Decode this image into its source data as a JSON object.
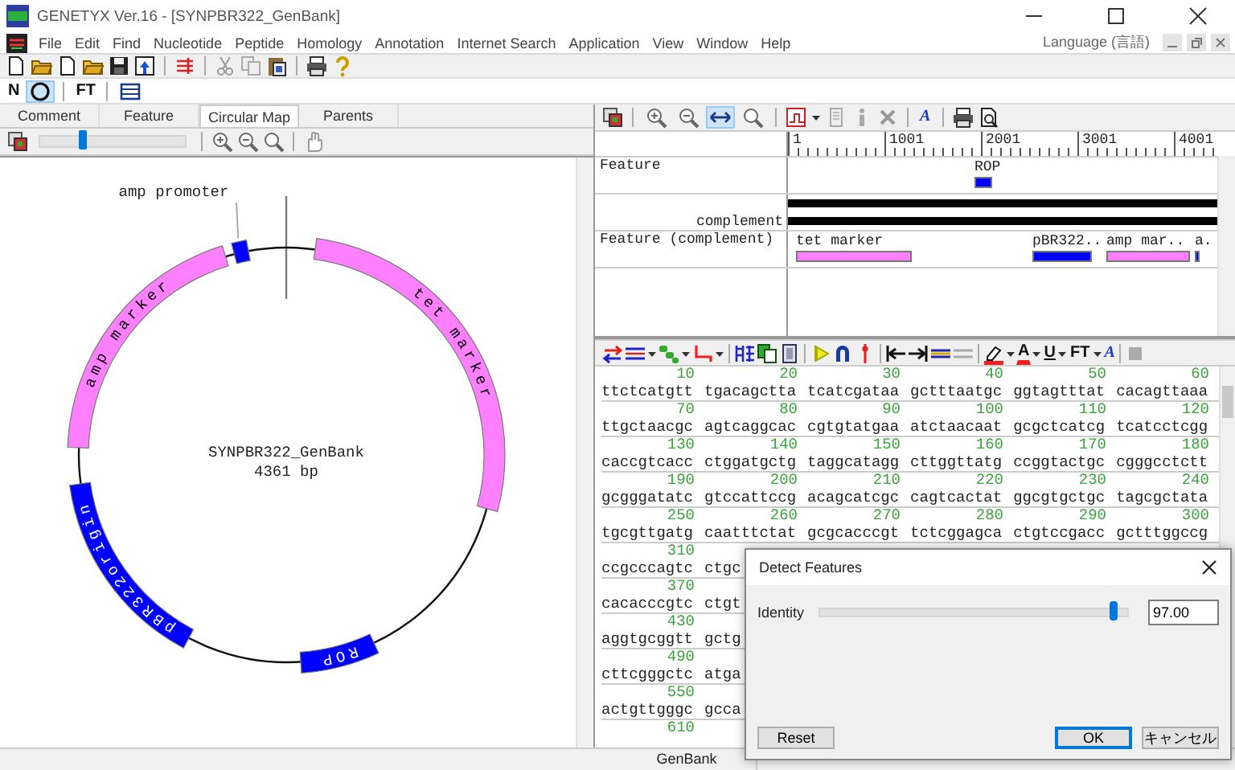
{
  "window": {
    "title": "GENETYX Ver.16 - [SYNPBR322_GenBank]"
  },
  "menu": [
    "File",
    "Edit",
    "Find",
    "Nucleotide",
    "Peptide",
    "Homology",
    "Annotation",
    "Internet Search",
    "Application",
    "View",
    "Window",
    "Help"
  ],
  "language": "Language (言語)",
  "main_toolbar": [
    [
      {
        "kind": "page"
      },
      {
        "kind": "folder"
      },
      {
        "kind": "page"
      },
      {
        "kind": "folder"
      },
      {
        "kind": "floppy"
      },
      {
        "kind": "floppy-blue"
      }
    ],
    [
      {
        "kind": "lines-red"
      }
    ],
    [
      {
        "kind": "scissors"
      },
      {
        "kind": "copy"
      },
      {
        "kind": "paste"
      }
    ],
    [
      {
        "kind": "printer"
      },
      {
        "kind": "help"
      }
    ]
  ],
  "view_toolbar": [
    [
      {
        "kind": "text",
        "label": "N",
        "selected": false
      },
      {
        "kind": "circle",
        "selected": true
      }
    ],
    [
      {
        "kind": "text",
        "label": "FT",
        "selected": false
      }
    ],
    [
      {
        "kind": "layout",
        "selected": false
      }
    ]
  ],
  "tabs": [
    {
      "label": "Comment",
      "selected": false
    },
    {
      "label": "Feature",
      "selected": false
    },
    {
      "label": "Circular Map",
      "selected": true
    },
    {
      "label": "Parents",
      "selected": false
    }
  ],
  "map_toolbar": {
    "leading": [
      [
        {
          "kind": "image"
        }
      ]
    ],
    "zoom_slider": {
      "level": 0.3
    },
    "tools": [
      [
        {
          "kind": "zoom-in"
        },
        {
          "kind": "zoom-out"
        },
        {
          "kind": "zoom"
        }
      ],
      [
        {
          "kind": "hand"
        }
      ]
    ]
  },
  "circular_map": {
    "name": "SYNPBR322_GenBank",
    "length": "4361 bp",
    "features": [
      {
        "label": "amp promoter",
        "color": "#0000ff",
        "kind": "callout"
      },
      {
        "label": "amp marker",
        "color": "#ff80ff",
        "kind": "band"
      },
      {
        "label": "tet marker",
        "color": "#ff80ff",
        "kind": "band"
      },
      {
        "label": "pBR322origin",
        "color": "#0000ff",
        "kind": "band"
      },
      {
        "label": "ROP",
        "color": "#0000ff",
        "kind": "band"
      }
    ]
  },
  "feature_toolbar": [
    [
      {
        "kind": "image"
      }
    ],
    [
      {
        "kind": "zoom-in",
        "selected": false
      },
      {
        "kind": "zoom-out",
        "selected": false
      },
      {
        "kind": "fit",
        "selected": true
      },
      {
        "kind": "zoom",
        "selected": false
      }
    ],
    [
      {
        "kind": "graph"
      },
      {
        "kind": "caret"
      },
      {
        "kind": "page-grey"
      },
      {
        "kind": "info"
      },
      {
        "kind": "cross"
      }
    ],
    [
      {
        "kind": "italic",
        "label": "A"
      }
    ],
    [
      {
        "kind": "printer"
      },
      {
        "kind": "preview"
      }
    ]
  ],
  "ruler": [
    "1",
    "1001",
    "2001",
    "3001",
    "4001"
  ],
  "feature_view": {
    "forward_label": "Feature",
    "complement_label": "complement",
    "complement_features_label": "Feature (complement)",
    "forward_features": [
      {
        "label": "ROP",
        "color": "#0000ff"
      }
    ],
    "complement_features": [
      {
        "label": "tet marker",
        "color": "#ff80ff"
      },
      {
        "label": "pBR322..",
        "color": "#0000ff"
      },
      {
        "label": "amp mar..",
        "color": "#ff80ff"
      },
      {
        "label": "a.",
        "color": "#0000ff"
      }
    ]
  },
  "sequence_toolbar": [
    [
      {
        "kind": "swap"
      },
      {
        "kind": "lines-blue"
      },
      {
        "kind": "caret"
      },
      {
        "kind": "chain"
      },
      {
        "kind": "caret"
      },
      {
        "kind": "step"
      },
      {
        "kind": "caret"
      }
    ],
    [
      {
        "kind": "grid-blue"
      },
      {
        "kind": "copy-green"
      },
      {
        "kind": "page-blue"
      }
    ],
    [
      {
        "kind": "marker"
      },
      {
        "kind": "lock"
      },
      {
        "kind": "pin"
      }
    ],
    [
      {
        "kind": "to-start"
      },
      {
        "kind": "to-end"
      },
      {
        "kind": "ruler"
      },
      {
        "kind": "lines-grey"
      }
    ],
    [
      {
        "kind": "pen"
      },
      {
        "kind": "caret"
      },
      {
        "kind": "font-color",
        "label": "A"
      },
      {
        "kind": "caret"
      },
      {
        "kind": "underline",
        "label": "U"
      },
      {
        "kind": "caret"
      },
      {
        "kind": "text",
        "label": "FT"
      },
      {
        "kind": "caret"
      },
      {
        "kind": "italic",
        "label": "A"
      }
    ],
    [
      {
        "kind": "square"
      }
    ]
  ],
  "sequence": [
    {
      "numbers": [
        "10",
        "20",
        "30",
        "40",
        "50",
        "60"
      ],
      "bases": [
        "ttctcatgtt",
        "tgacagctta",
        "tcatcgataa",
        "gctttaatgc",
        "ggtagtttat",
        "cacagttaaa"
      ]
    },
    {
      "numbers": [
        "70",
        "80",
        "90",
        "100",
        "110",
        "120"
      ],
      "bases": [
        "ttgctaacgc",
        "agtcaggcac",
        "cgtgtatgaa",
        "atctaacaat",
        "gcgctcatcg",
        "tcatcctcgg"
      ]
    },
    {
      "numbers": [
        "130",
        "140",
        "150",
        "160",
        "170",
        "180"
      ],
      "bases": [
        "caccgtcacc",
        "ctggatgctg",
        "taggcatagg",
        "cttggttatg",
        "ccggtactgc",
        "cgggcctctt"
      ]
    },
    {
      "numbers": [
        "190",
        "200",
        "210",
        "220",
        "230",
        "240"
      ],
      "bases": [
        "gcgggatatc",
        "gtccattccg",
        "acagcatcgc",
        "cagtcactat",
        "ggcgtgctgc",
        "tagcgctata"
      ]
    },
    {
      "numbers": [
        "250",
        "260",
        "270",
        "280",
        "290",
        "300"
      ],
      "bases": [
        "tgcgttgatg",
        "caatttctat",
        "gcgcacccgt",
        "tctcggagca",
        "ctgtccgacc",
        "gctttggccg"
      ]
    },
    {
      "numbers": [
        "310"
      ],
      "bases": [
        "ccgcccagtc",
        "ctgc"
      ]
    },
    {
      "numbers": [
        "370"
      ],
      "bases": [
        "cacacccgtc",
        "ctgt"
      ]
    },
    {
      "numbers": [
        "430"
      ],
      "bases": [
        "aggtgcggtt",
        "gctg"
      ]
    },
    {
      "numbers": [
        "490"
      ],
      "bases": [
        "cttcgggctc",
        "atga"
      ]
    },
    {
      "numbers": [
        "550"
      ],
      "bases": [
        "actgttgggc",
        "gcca"
      ]
    },
    {
      "numbers": [
        "610"
      ]
    }
  ],
  "dialog": {
    "title": "Detect Features",
    "label": "Identity",
    "level": 0.96,
    "value": "97.00",
    "buttons": [
      {
        "label": "Reset",
        "default": false
      },
      {
        "label": "OK",
        "default": true
      },
      {
        "label": "キャンセル",
        "default": false
      }
    ]
  },
  "status_bar": [
    "GenBank"
  ]
}
